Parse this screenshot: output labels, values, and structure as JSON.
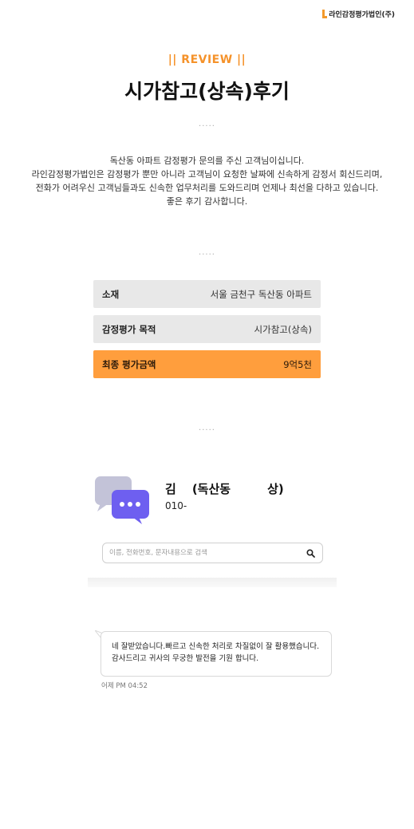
{
  "header": {
    "logo_text": "라인감정평가법인(주)"
  },
  "hero": {
    "tag": "|| REVIEW ||",
    "title": "시가참고(상속)후기",
    "separator": "....."
  },
  "description": [
    "독산동 아파트 감정평가 문의를 주신 고객님이십니다.",
    "라인감정평가법인은 감정평가 뿐만 아니라 고객님이 요청한 날짜에 신속하게 감정서 회신드리며,",
    "전화가 어려우신 고객님들과도 신속한 업무처리를 도와드리며 언제나 최선을 다하고 있습니다.",
    "좋은 후기 감사합니다."
  ],
  "details": [
    {
      "label": "소재",
      "value": "서울 금천구 독산동 아파트"
    },
    {
      "label": "감정평가 목적",
      "value": "시가참고(상속)"
    },
    {
      "label": "최종 평가금액",
      "value": "9억5천"
    }
  ],
  "chat": {
    "contact_name_prefix": "김",
    "contact_name_mid": "(독산동",
    "contact_name_suffix": "상)",
    "contact_phone": "010-",
    "search_placeholder": "이름, 전화번호, 문자내용으로 검색",
    "message_lines": [
      "네 잘받았습니다.빠르고 신속한 처리로 차질없이 잘 활용했습니다.",
      "감사드리고 귀사의 무궁한 발전을 기원 합니다."
    ],
    "message_time": "어제 PM 04:52"
  },
  "colors": {
    "accent": "#f5922a",
    "highlight_row": "#ff9e3d",
    "chat_icon": "#6e5ff0"
  }
}
